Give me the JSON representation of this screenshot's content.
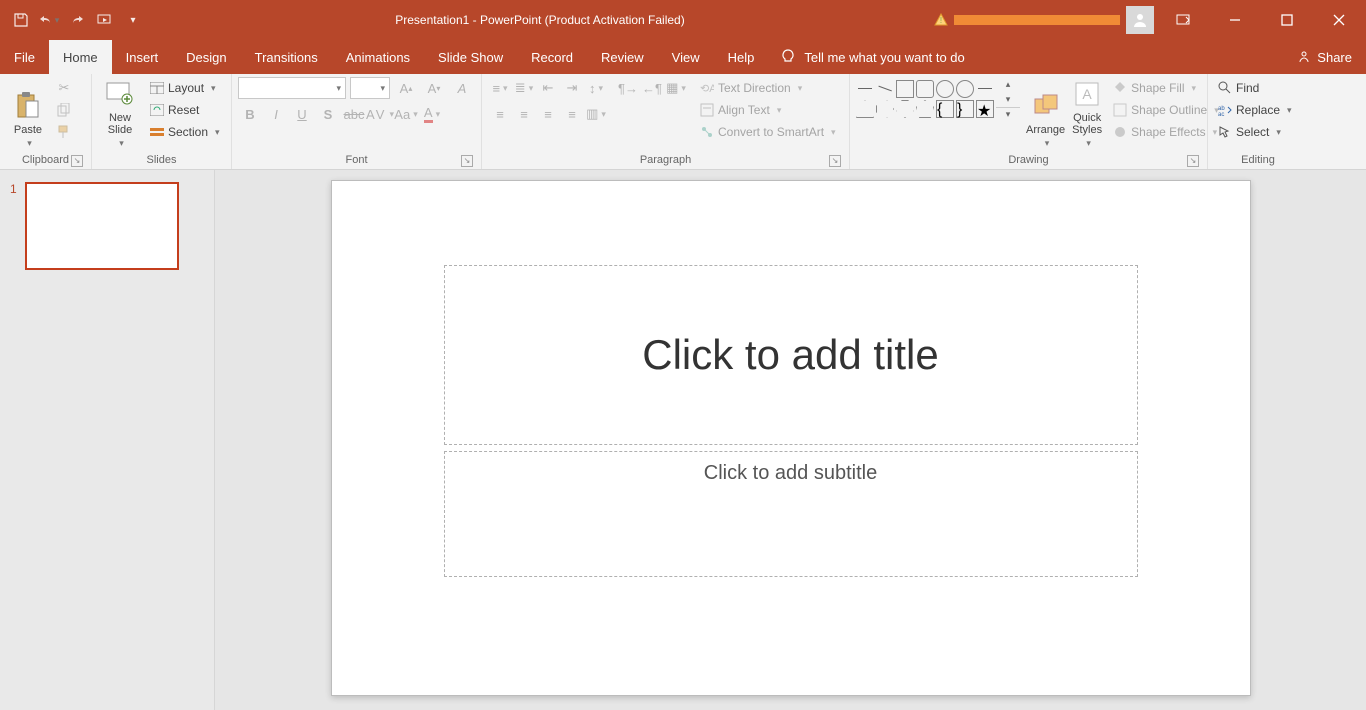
{
  "titlebar": {
    "title": "Presentation1  -  PowerPoint (Product Activation Failed)"
  },
  "tabs": {
    "file": "File",
    "items": [
      "Home",
      "Insert",
      "Design",
      "Transitions",
      "Animations",
      "Slide Show",
      "Record",
      "Review",
      "View",
      "Help"
    ],
    "active_index": 0,
    "tellme": "Tell me what you want to do",
    "share": "Share"
  },
  "ribbon": {
    "clipboard": {
      "label": "Clipboard",
      "paste": "Paste"
    },
    "slides": {
      "label": "Slides",
      "new_slide": "New\nSlide",
      "layout": "Layout",
      "reset": "Reset",
      "section": "Section"
    },
    "font": {
      "label": "Font"
    },
    "paragraph": {
      "label": "Paragraph",
      "text_direction": "Text Direction",
      "align_text": "Align Text",
      "convert_smartart": "Convert to SmartArt"
    },
    "drawing": {
      "label": "Drawing",
      "arrange": "Arrange",
      "quick_styles": "Quick\nStyles",
      "shape_fill": "Shape Fill",
      "shape_outline": "Shape Outline",
      "shape_effects": "Shape Effects"
    },
    "editing": {
      "label": "Editing",
      "find": "Find",
      "replace": "Replace",
      "select": "Select"
    }
  },
  "thumbnails": {
    "slide_number": "1"
  },
  "slide": {
    "title_placeholder": "Click to add title",
    "subtitle_placeholder": "Click to add subtitle"
  }
}
